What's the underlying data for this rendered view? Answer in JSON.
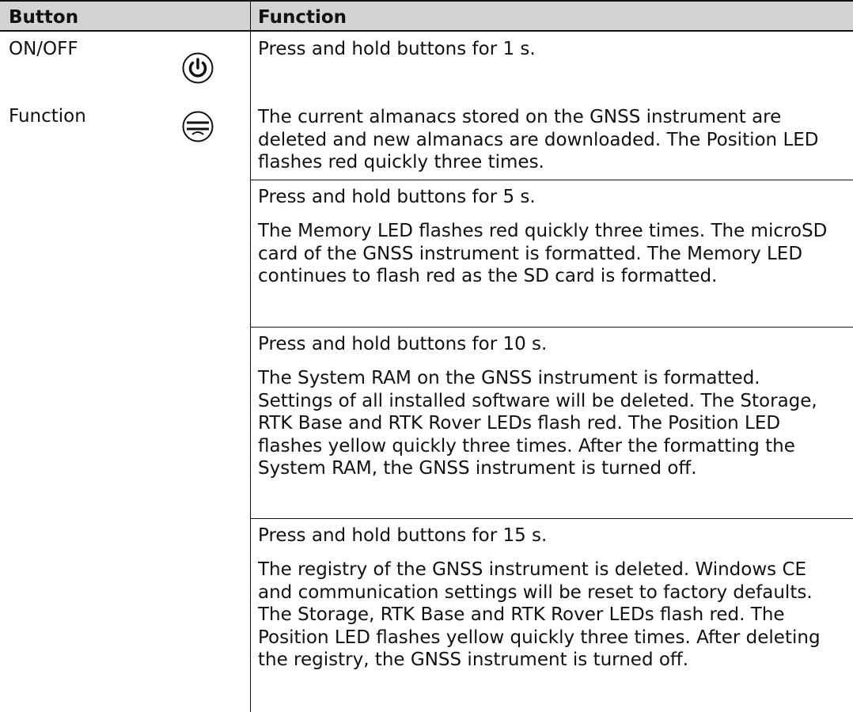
{
  "header": {
    "button": "Button",
    "function": "Function"
  },
  "rows": [
    {
      "button": "ON/OFF",
      "icon": "power-icon",
      "text": "Press and hold buttons for 1 s."
    },
    {
      "button": "Function",
      "icon": "function-button-icon",
      "text": "The current almanacs stored on the GNSS instrument are deleted and new almanacs are downloaded. The Position LED flashes red quickly three times."
    }
  ],
  "blocks": [
    {
      "title": "Press and hold buttons for 5 s.",
      "text": "The Memory LED flashes red quickly three times. The microSD card of the GNSS instrument is formatted. The Memory LED continues to flash red as the SD card is formatted."
    },
    {
      "title": "Press and hold buttons for 10 s.",
      "text": "The System RAM on the GNSS instrument is formatted. Settings of all installed software will be deleted. The Storage, RTK Base and RTK Rover LEDs flash red. The Position LED flashes yellow quickly three times. After the formatting the System RAM, the GNSS instrument is turned off."
    },
    {
      "title": "Press and hold buttons for 15 s.",
      "text": "The registry of the GNSS instrument is deleted. Windows CE and communication settings will be reset to factory defaults. The Storage, RTK Base and RTK Rover LEDs flash red. The Position LED flashes yellow quickly three times. After deleting the registry, the GNSS instrument is turned off."
    }
  ]
}
